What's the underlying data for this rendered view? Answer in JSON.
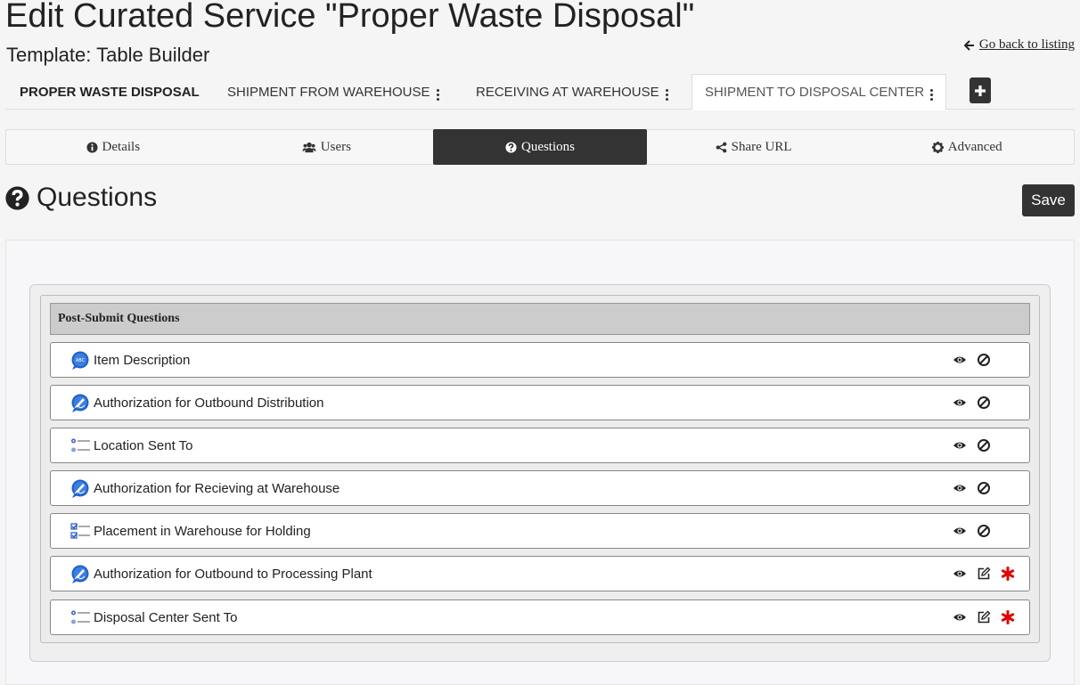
{
  "page": {
    "title": "Edit Curated Service \"Proper Waste Disposal\"",
    "template_label": "Template: Table Builder",
    "back_link": "Go back to listing"
  },
  "service_tabs": [
    {
      "label": "PROPER WASTE DISPOSAL"
    },
    {
      "label": "SHIPMENT FROM WAREHOUSE"
    },
    {
      "label": "RECEIVING AT WAREHOUSE"
    },
    {
      "label": "SHIPMENT TO DISPOSAL CENTER"
    }
  ],
  "sub_nav": [
    {
      "label": "Details",
      "icon": "info-circle-icon"
    },
    {
      "label": "Users",
      "icon": "users-icon"
    },
    {
      "label": "Questions",
      "icon": "question-circle-icon",
      "active": true
    },
    {
      "label": "Share URL",
      "icon": "share-icon"
    },
    {
      "label": "Advanced",
      "icon": "gear-icon"
    }
  ],
  "section": {
    "heading": "Questions",
    "save_label": "Save"
  },
  "questions_panel": {
    "header": "Post-Submit Questions",
    "items": [
      {
        "label": "Item Description",
        "type_icon": "text-bubble-icon",
        "actions": [
          "view-icon",
          "disabled-icon"
        ]
      },
      {
        "label": "Authorization for Outbound Distribution",
        "type_icon": "signature-bubble-icon",
        "actions": [
          "view-icon",
          "disabled-icon"
        ]
      },
      {
        "label": "Location Sent To",
        "type_icon": "radio-list-icon",
        "actions": [
          "view-icon",
          "disabled-icon"
        ]
      },
      {
        "label": "Authorization for Recieving at Warehouse",
        "type_icon": "signature-bubble-icon",
        "actions": [
          "view-icon",
          "disabled-icon"
        ]
      },
      {
        "label": "Placement in Warehouse for Holding",
        "type_icon": "checkbox-list-icon",
        "actions": [
          "view-icon",
          "disabled-icon"
        ]
      },
      {
        "label": "Authorization for Outbound to Processing Plant",
        "type_icon": "signature-bubble-icon",
        "actions": [
          "view-icon",
          "edit-icon",
          "required-icon"
        ]
      },
      {
        "label": "Disposal Center Sent To",
        "type_icon": "radio-list-icon",
        "actions": [
          "view-icon",
          "edit-icon",
          "required-icon"
        ]
      }
    ]
  },
  "colors": {
    "dark": "#333333",
    "required": "#e00000",
    "icon_blue": "#1f5fc9"
  }
}
